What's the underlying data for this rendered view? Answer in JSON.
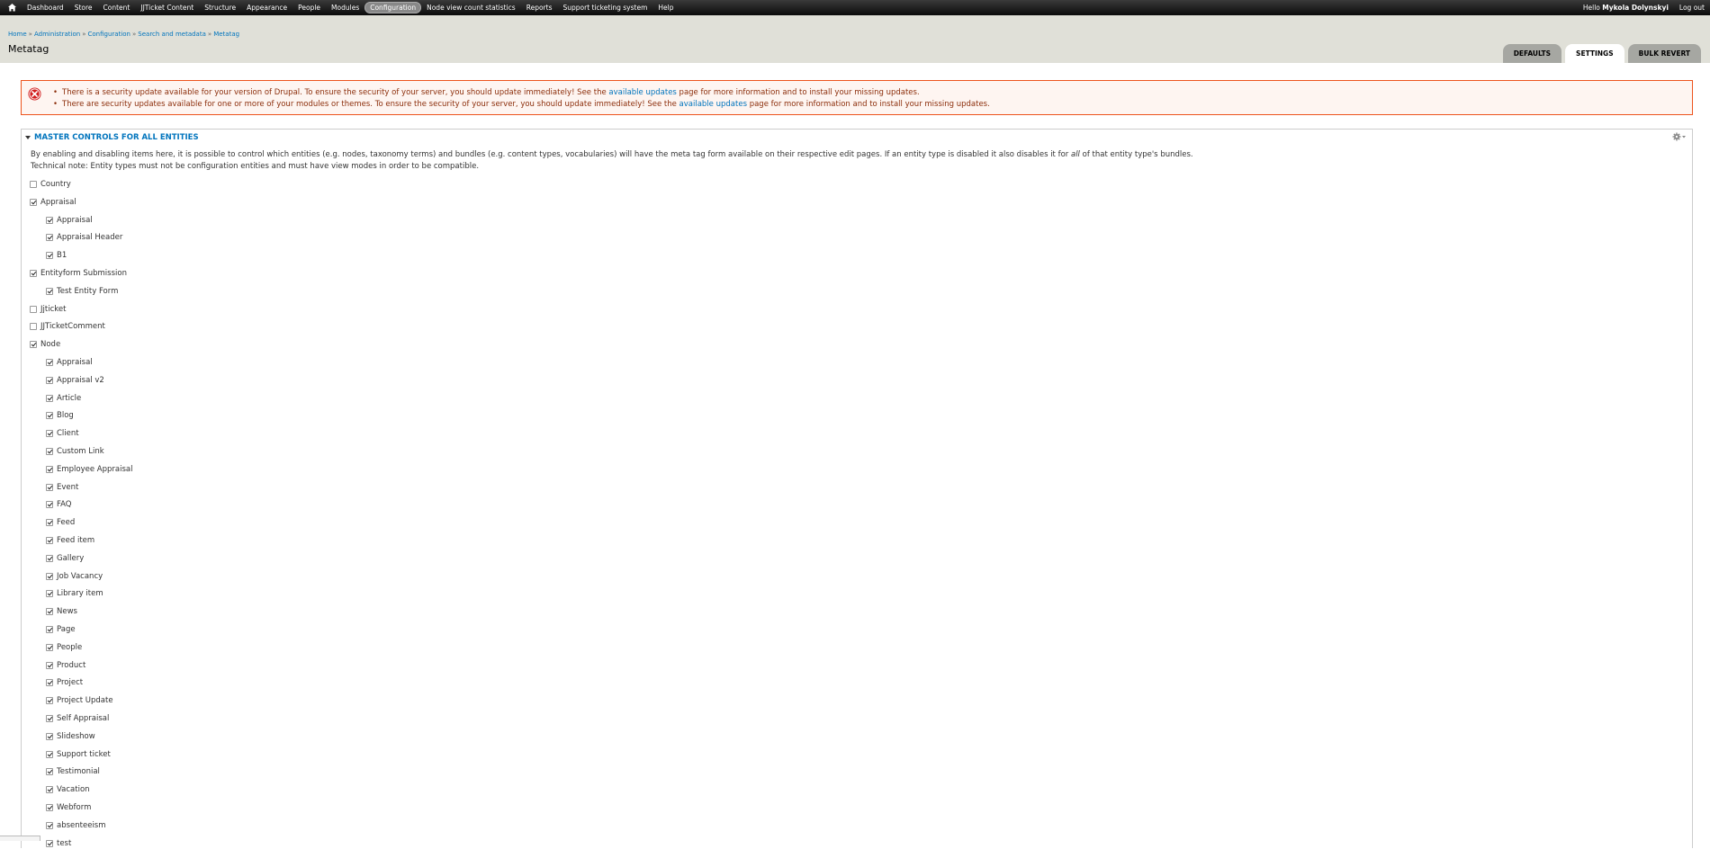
{
  "toolbar": {
    "menu": [
      "Dashboard",
      "Store",
      "Content",
      "JJTicket Content",
      "Structure",
      "Appearance",
      "People",
      "Modules",
      "Configuration",
      "Node view count statistics",
      "Reports",
      "Support ticketing system",
      "Help"
    ],
    "active_item": "Configuration",
    "greeting": "Hello",
    "username": "Mykola Dolynskyi",
    "logout": "Log out"
  },
  "breadcrumb": {
    "items": [
      "Home",
      "Administration",
      "Configuration",
      "Search and metadata",
      "Metatag"
    ],
    "separator": "»"
  },
  "page_title": "Metatag",
  "tabs": [
    {
      "label": "DEFAULTS",
      "active": false
    },
    {
      "label": "SETTINGS",
      "active": true
    },
    {
      "label": "BULK REVERT",
      "active": false
    }
  ],
  "messages": {
    "msg1": {
      "before": "There is a security update available for your version of Drupal. To ensure the security of your server, you should update immediately! See the ",
      "link": "available updates",
      "after": " page for more information and to install your missing updates."
    },
    "msg2": {
      "before": "There are security updates available for one or more of your modules or themes. To ensure the security of your server, you should update immediately! See the ",
      "link": "available updates",
      "after": " page for more information and to install your missing updates."
    }
  },
  "fieldset": {
    "legend": "MASTER CONTROLS FOR ALL ENTITIES",
    "desc1_before": "By enabling and disabling items here, it is possible to control which entities (e.g. nodes, taxonomy terms) and bundles (e.g. content types, vocabularies) will have the meta tag form available on their respective edit pages. If an entity type is disabled it also disables it for ",
    "desc1_em": "all",
    "desc1_after": " of that entity type's bundles.",
    "desc2": "Technical note: Entity types must not be configuration entities and must have view modes in order to be compatible."
  },
  "entities": [
    {
      "label": "Country",
      "checked": false,
      "level": 0
    },
    {
      "label": "Appraisal",
      "checked": true,
      "level": 0
    },
    {
      "label": "Appraisal",
      "checked": true,
      "level": 1
    },
    {
      "label": "Appraisal Header",
      "checked": true,
      "level": 1
    },
    {
      "label": "B1",
      "checked": true,
      "level": 1
    },
    {
      "label": "Entityform Submission",
      "checked": true,
      "level": 0
    },
    {
      "label": "Test Entity Form",
      "checked": true,
      "level": 1
    },
    {
      "label": "Jjticket",
      "checked": false,
      "level": 0
    },
    {
      "label": "JJTicketComment",
      "checked": false,
      "level": 0
    },
    {
      "label": "Node",
      "checked": true,
      "level": 0
    },
    {
      "label": "Appraisal",
      "checked": true,
      "level": 1
    },
    {
      "label": "Appraisal v2",
      "checked": true,
      "level": 1
    },
    {
      "label": "Article",
      "checked": true,
      "level": 1
    },
    {
      "label": "Blog",
      "checked": true,
      "level": 1
    },
    {
      "label": "Client",
      "checked": true,
      "level": 1
    },
    {
      "label": "Custom Link",
      "checked": true,
      "level": 1
    },
    {
      "label": "Employee Appraisal",
      "checked": true,
      "level": 1
    },
    {
      "label": "Event",
      "checked": true,
      "level": 1
    },
    {
      "label": "FAQ",
      "checked": true,
      "level": 1
    },
    {
      "label": "Feed",
      "checked": true,
      "level": 1
    },
    {
      "label": "Feed item",
      "checked": true,
      "level": 1
    },
    {
      "label": "Gallery",
      "checked": true,
      "level": 1
    },
    {
      "label": "Job Vacancy",
      "checked": true,
      "level": 1
    },
    {
      "label": "Library item",
      "checked": true,
      "level": 1
    },
    {
      "label": "News",
      "checked": true,
      "level": 1
    },
    {
      "label": "Page",
      "checked": true,
      "level": 1
    },
    {
      "label": "People",
      "checked": true,
      "level": 1
    },
    {
      "label": "Product",
      "checked": true,
      "level": 1
    },
    {
      "label": "Project",
      "checked": true,
      "level": 1
    },
    {
      "label": "Project Update",
      "checked": true,
      "level": 1
    },
    {
      "label": "Self Appraisal",
      "checked": true,
      "level": 1
    },
    {
      "label": "Slideshow",
      "checked": true,
      "level": 1
    },
    {
      "label": "Support ticket",
      "checked": true,
      "level": 1
    },
    {
      "label": "Testimonial",
      "checked": true,
      "level": 1
    },
    {
      "label": "Vacation",
      "checked": true,
      "level": 1
    },
    {
      "label": "Webform",
      "checked": true,
      "level": 1
    },
    {
      "label": "absenteeism",
      "checked": true,
      "level": 1
    },
    {
      "label": "test",
      "checked": true,
      "level": 1
    }
  ]
}
